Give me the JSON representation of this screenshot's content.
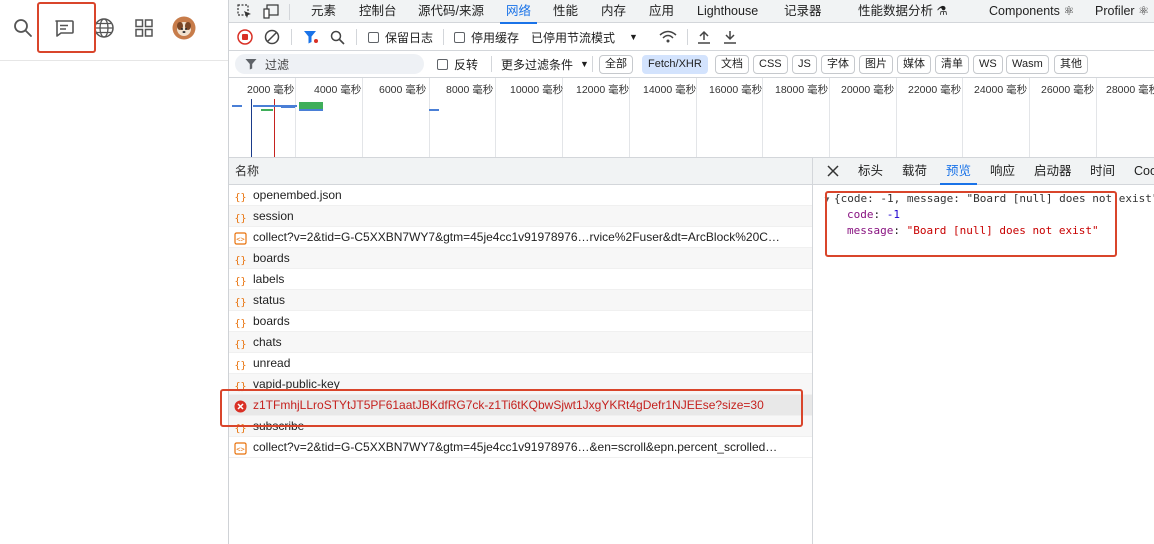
{
  "devtools": {
    "tabs": [
      "元素",
      "控制台",
      "源代码/来源",
      "网络",
      "性能",
      "内存",
      "应用",
      "Lighthouse",
      "记录器",
      "性能数据分析 ⚗",
      "Components ⚛",
      "Profiler ⚛"
    ],
    "active_tab": "网络",
    "toolbar": {
      "preserve_log": "保留日志",
      "disable_cache": "停用缓存",
      "throttle": "已停用节流模式"
    },
    "filter": {
      "placeholder": "过滤",
      "invert": "反转",
      "more_filters": "更多过滤条件",
      "chips": [
        "全部",
        "Fetch/XHR",
        "文档",
        "CSS",
        "JS",
        "字体",
        "图片",
        "媒体",
        "清单",
        "WS",
        "Wasm",
        "其他"
      ],
      "selected_chip": "Fetch/XHR"
    },
    "timeline_ticks": [
      "2000 毫秒",
      "4000 毫秒",
      "6000 毫秒",
      "8000 毫秒",
      "10000 毫秒",
      "12000 毫秒",
      "14000 毫秒",
      "16000 毫秒",
      "18000 毫秒",
      "20000 毫秒",
      "22000 毫秒",
      "24000 毫秒",
      "26000 毫秒",
      "28000 毫秒"
    ],
    "request_list": {
      "header": "名称",
      "rows": [
        {
          "name": "openembed.json",
          "icon": "xhr-icon",
          "error": false
        },
        {
          "name": "session",
          "icon": "xhr-icon",
          "error": false
        },
        {
          "name": "collect?v=2&tid=G-C5XXBN7WY7&gtm=45je4cc1v91978976…rvice%2Fuser&dt=ArcBlock%20C…",
          "icon": "doc-icon",
          "error": false
        },
        {
          "name": "boards",
          "icon": "xhr-icon",
          "error": false
        },
        {
          "name": "labels",
          "icon": "xhr-icon",
          "error": false
        },
        {
          "name": "status",
          "icon": "xhr-icon",
          "error": false
        },
        {
          "name": "boards",
          "icon": "xhr-icon",
          "error": false
        },
        {
          "name": "chats",
          "icon": "xhr-icon",
          "error": false
        },
        {
          "name": "unread",
          "icon": "xhr-icon",
          "error": false
        },
        {
          "name": "vapid-public-key",
          "icon": "xhr-icon",
          "error": false
        },
        {
          "name": "z1TFmhjLLroSTYtJT5PF61aatJBKdfRG7ck-z1Ti6tKQbwSjwt1JxgYKRt4gDefr1NJEEse?size=30",
          "icon": "error-icon",
          "error": true
        },
        {
          "name": "subscribe",
          "icon": "xhr-icon",
          "error": false
        },
        {
          "name": "collect?v=2&tid=G-C5XXBN7WY7&gtm=45je4cc1v91978976…&en=scroll&epn.percent_scrolled…",
          "icon": "doc-icon",
          "error": false
        }
      ]
    },
    "detail": {
      "tabs": [
        "标头",
        "载荷",
        "预览",
        "响应",
        "启动器",
        "时间",
        "Coo"
      ],
      "active_tab": "预览",
      "preview": {
        "summary": "{code: -1, message: \"Board [null] does not exist\"}",
        "code_key": "code",
        "code_value": "-1",
        "message_key": "message",
        "message_value": "\"Board [null] does not exist\""
      }
    }
  },
  "colors": {
    "accent": "#1a73e8",
    "highlight": "#d9452b",
    "error": "#c5221f"
  }
}
